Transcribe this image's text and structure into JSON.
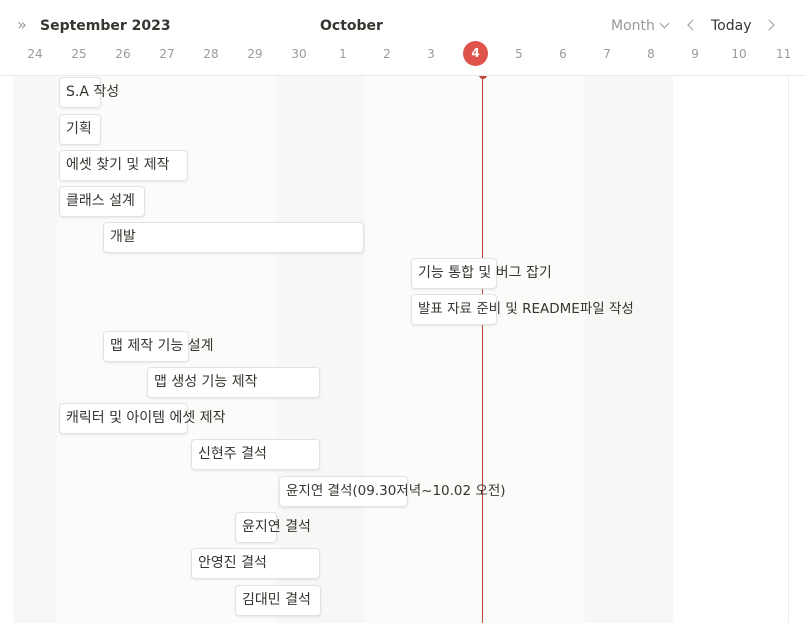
{
  "header": {
    "left_month": "September 2023",
    "center_month": "October",
    "view_mode": "Month",
    "today_label": "Today"
  },
  "days": [
    "24",
    "25",
    "26",
    "27",
    "28",
    "29",
    "30",
    "1",
    "2",
    "3",
    "4",
    "5",
    "6",
    "7",
    "8",
    "9",
    "10",
    "11"
  ],
  "today_day": "4",
  "tasks": [
    {
      "label": "S.A 작성"
    },
    {
      "label": "기획"
    },
    {
      "label": "에셋 찾기 및 제작"
    },
    {
      "label": "클래스 설계"
    },
    {
      "label": "개발"
    },
    {
      "label": "기능 통합 및 버그 잡기"
    },
    {
      "label": "발표 자료 준비 및 README파일 작성"
    },
    {
      "label": "맵 제작 기능 설계"
    },
    {
      "label": "맵 생성 기능 제작"
    },
    {
      "label": "캐릭터 및 아이템 에셋 제작"
    },
    {
      "label": "신현주 결석"
    },
    {
      "label": "윤지연 결석(09.30저녁~10.02 오전)"
    },
    {
      "label": "윤지연 결석"
    },
    {
      "label": "안영진 결석"
    },
    {
      "label": "김대민 결석"
    }
  ]
}
